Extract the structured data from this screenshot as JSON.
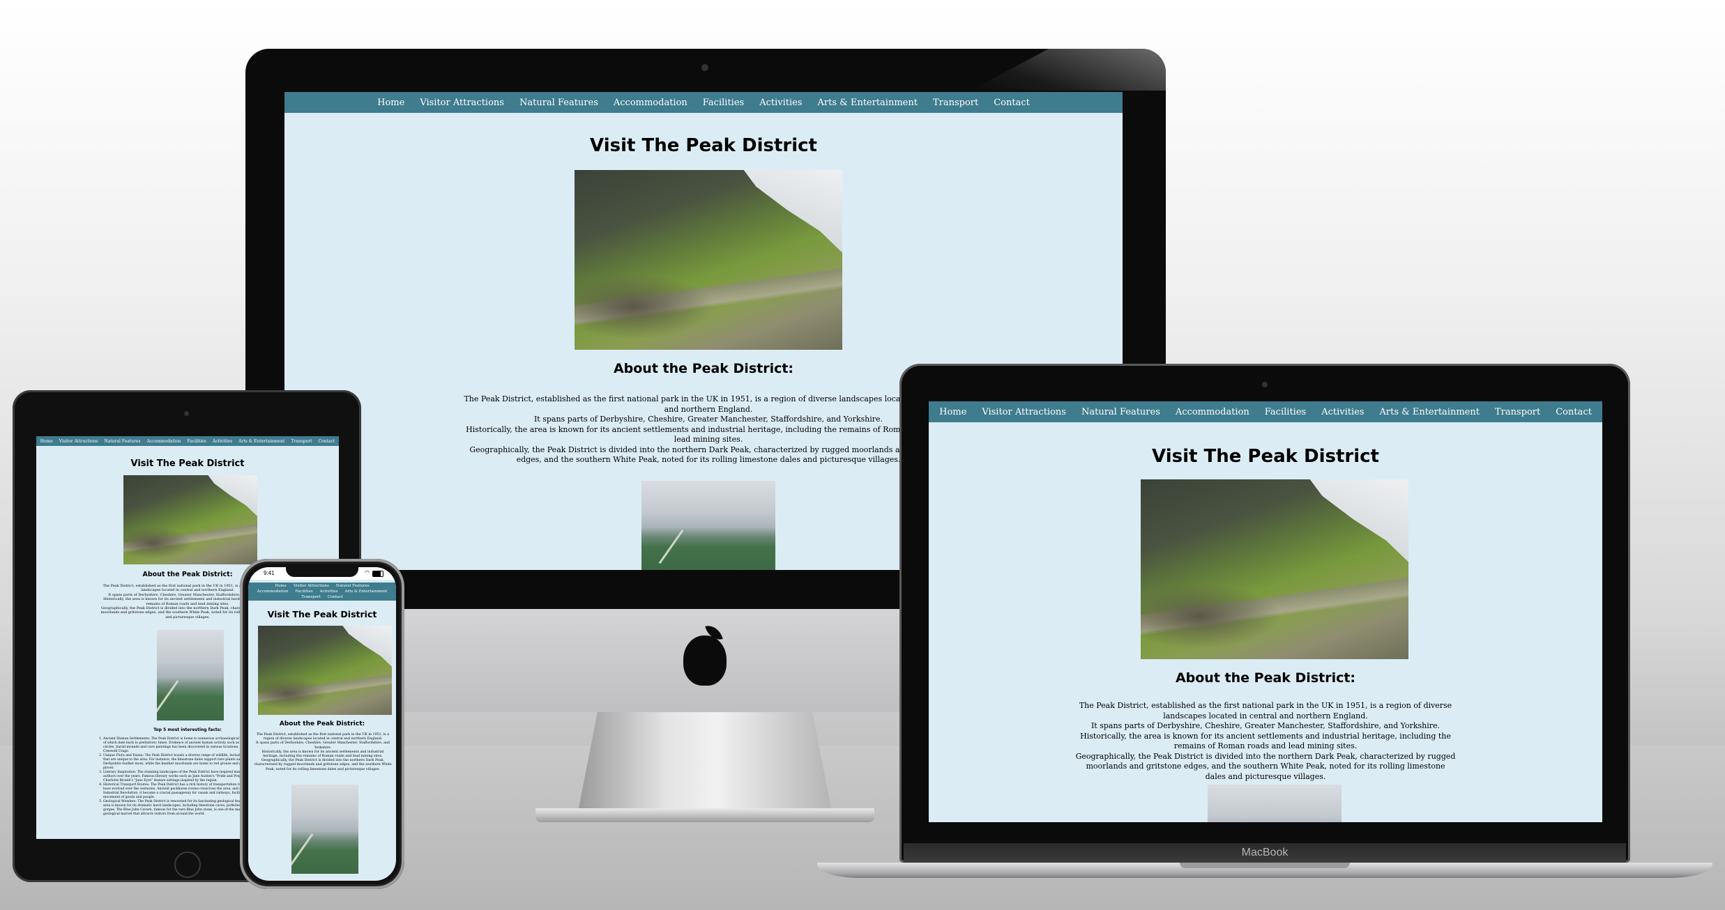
{
  "site": {
    "nav": [
      "Home",
      "Visitor Attractions",
      "Natural Features",
      "Accommodation",
      "Facilities",
      "Activities",
      "Arts & Entertainment",
      "Transport",
      "Contact"
    ],
    "title": "Visit The Peak District",
    "about_heading": "About the Peak District:",
    "about_p1": "The Peak District, established as the first national park in the UK in 1951, is a region of diverse landscapes located in central and northern England.",
    "about_p2": "It spans parts of Derbyshire, Cheshire, Greater Manchester, Staffordshire, and Yorkshire.",
    "about_p3": "Historically, the area is known for its ancient settlements and industrial heritage, including the remains of Roman roads and lead mining sites.",
    "about_p4": "Geographically, the Peak District is divided into the northern Dark Peak, characterized by rugged moorlands and gritstone edges, and the southern White Peak, noted for its rolling limestone dales and picturesque villages.",
    "facts_heading": "Top 5 most interesting facts:",
    "facts": [
      "Ancient Human Settlements: The Peak District is home to numerous archaeological sites, some of which date back to prehistoric times. Evidence of ancient human activity such as stone circles, burial mounds and cave paintings has been discovered in various locations, including Creswell Crags.",
      "Unique Flora and Fauna: The Peak District boasts a diverse range of wildlife, including species that are unique to the area. For instance, the limestone dales support rare plants such as the Derbyshire feather moss, while the heather moorlands are home to red grouse and golden plover.",
      "Literary Inspiration: The stunning landscapes of the Peak District have inspired many famous authors over the years. Famous literary works such as Jane Austen's \"Pride and Prejudice\" and Charlotte Brontë's \"Jane Eyre\" feature settings inspired by the region.",
      "Historical Transport Routes: The Peak District has a rich history of transportation routes that have evolved over the centuries. Ancient packhorse routes crisscross the area, and during the Industrial Revolution, it became a crucial passageway for canals and railways, facilitating the movement of goods and people.",
      "Geological Wonders: The Peak District is renowned for its fascinating geological features. The area is known for its dramatic karst landscapes, including limestone caves, potholes and gorges. The Blue John Cavern, famous for the rare Blue John stone, is one of the many geological marvel that attracts visitors from around the world."
    ]
  },
  "devices": {
    "laptop_brand": "MacBook",
    "phone_time": "9:41"
  }
}
